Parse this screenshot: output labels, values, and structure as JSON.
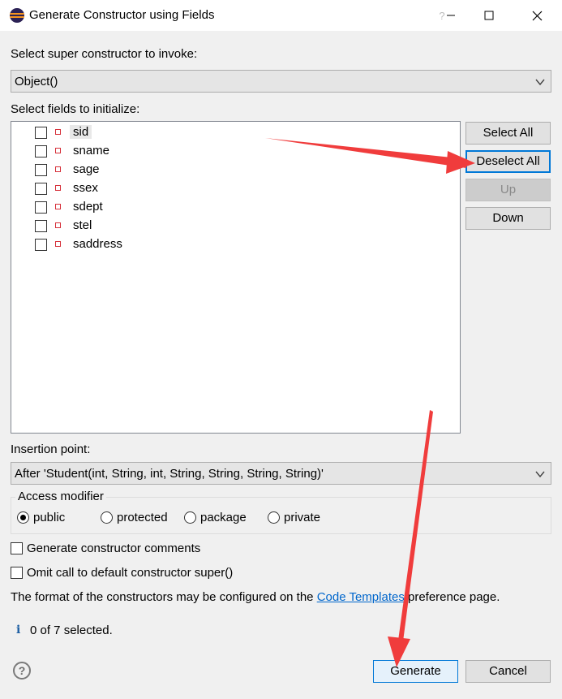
{
  "window": {
    "title": "Generate Constructor using Fields",
    "help_glyph": "?",
    "minimize_label": "—",
    "maximize_label": "☐",
    "close_label": "✕"
  },
  "super_constructor": {
    "label": "Select super constructor to invoke:",
    "value": "Object()"
  },
  "fields": {
    "label": "Select fields to initialize:",
    "items": [
      {
        "name": "sid",
        "checked": false
      },
      {
        "name": "sname",
        "checked": false
      },
      {
        "name": "sage",
        "checked": false
      },
      {
        "name": "ssex",
        "checked": false
      },
      {
        "name": "sdept",
        "checked": false
      },
      {
        "name": "stel",
        "checked": false
      },
      {
        "name": "saddress",
        "checked": false
      }
    ]
  },
  "side_buttons": {
    "select_all": "Select All",
    "deselect_all": "Deselect All",
    "up": "Up",
    "down": "Down"
  },
  "insertion_point": {
    "label": "Insertion point:",
    "value": "After 'Student(int, String, int, String, String, String, String)'"
  },
  "access_modifier": {
    "label": "Access modifier",
    "options": [
      "public",
      "protected",
      "package",
      "private"
    ],
    "selected": "public"
  },
  "options": {
    "generate_comments": "Generate constructor comments",
    "omit_super": "Omit call to default constructor super()"
  },
  "info_text": {
    "before": "The format of the constructors may be configured on the ",
    "link": "Code Templates",
    "after": " preference page."
  },
  "status": {
    "icon_glyph": "i",
    "text": "0 of 7 selected."
  },
  "footer": {
    "help_glyph": "?",
    "generate": "Generate",
    "cancel": "Cancel"
  },
  "colors": {
    "annotation_red": "#f03c3c",
    "focus_blue": "#0078d7"
  }
}
